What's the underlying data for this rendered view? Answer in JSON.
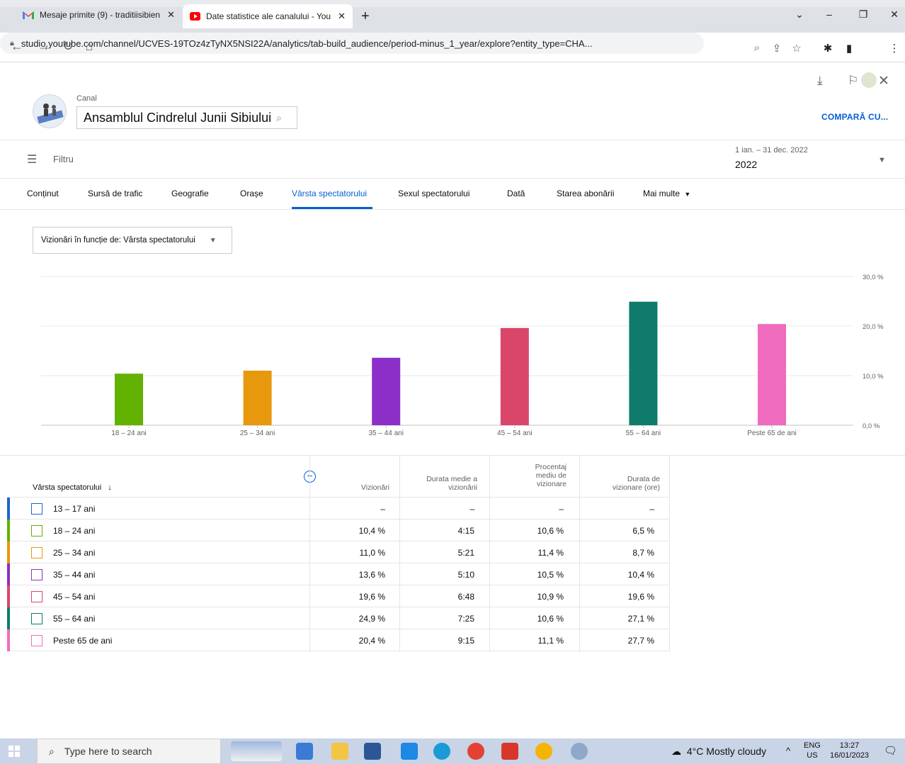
{
  "browser": {
    "tabs": [
      {
        "title": "Mesaje primite (9) - traditiisibien"
      },
      {
        "title": "Date statistice ale canalului - You"
      }
    ],
    "url": "studio.youtube.com/channel/UCVES-19TOz4zTyNX5NSI22A/analytics/tab-build_audience/period-minus_1_year/explore?entity_type=CHA..."
  },
  "header": {
    "canal_label": "Canal",
    "channel_name": "Ansamblul Cindrelul Junii Sibiului",
    "compare_label": "COMPARĂ CU..."
  },
  "filter": {
    "label": "Filtru",
    "date_range": "1 ian. – 31 dec. 2022",
    "date_value": "2022"
  },
  "report_tabs": [
    {
      "label": "Conținut"
    },
    {
      "label": "Sursă de trafic"
    },
    {
      "label": "Geografie"
    },
    {
      "label": "Orașe"
    },
    {
      "label": "Vârsta spectatorului",
      "active": true
    },
    {
      "label": "Sexul spectatorului"
    },
    {
      "label": "Dată"
    },
    {
      "label": "Starea abonării"
    },
    {
      "label": "Mai multe"
    }
  ],
  "metric_select": {
    "label": "Vizionări în funcție de: Vârsta spectatorului"
  },
  "chart_data": {
    "type": "bar",
    "title": "",
    "xlabel": "",
    "ylabel": "",
    "categories": [
      "18 – 24 ani",
      "25 – 34 ani",
      "35 – 44 ani",
      "45 – 54 ani",
      "55 – 64 ani",
      "Peste 65 de ani"
    ],
    "values": [
      10.4,
      11.0,
      13.6,
      19.6,
      24.9,
      20.4
    ],
    "colors": [
      "#63b100",
      "#e8980d",
      "#8c2fc9",
      "#d9466a",
      "#0f7b6c",
      "#ef6cbe"
    ],
    "ylim": [
      0,
      30
    ],
    "yticks": [
      "0,0 %",
      "10,0 %",
      "20,0 %",
      "30,0 %"
    ],
    "grid": true
  },
  "table": {
    "headers": {
      "dimension": "Vârsta spectatorului",
      "views": "Vizionări",
      "avg_duration": [
        "Durata medie a",
        "vizionării"
      ],
      "avg_percent": [
        "Procentaj",
        "mediu de",
        "vizionare"
      ],
      "watch_time": [
        "Durata de",
        "vizionare (ore)"
      ]
    },
    "rows": [
      {
        "label": "13 – 17 ani",
        "views": "–",
        "avg_duration": "–",
        "avg_percent": "–",
        "watch_time": "–",
        "color": "#1b66c9"
      },
      {
        "label": "18 – 24 ani",
        "views": "10,4 %",
        "avg_duration": "4:15",
        "avg_percent": "10,6 %",
        "watch_time": "6,5 %",
        "color": "#63b100"
      },
      {
        "label": "25 – 34 ani",
        "views": "11,0 %",
        "avg_duration": "5:21",
        "avg_percent": "11,4 %",
        "watch_time": "8,7 %",
        "color": "#e8980d"
      },
      {
        "label": "35 – 44 ani",
        "views": "13,6 %",
        "avg_duration": "5:10",
        "avg_percent": "10,5 %",
        "watch_time": "10,4 %",
        "color": "#8c2fc9"
      },
      {
        "label": "45 – 54 ani",
        "views": "19,6 %",
        "avg_duration": "6:48",
        "avg_percent": "10,9 %",
        "watch_time": "19,6 %",
        "color": "#d9466a"
      },
      {
        "label": "55 – 64 ani",
        "views": "24,9 %",
        "avg_duration": "7:25",
        "avg_percent": "10,6 %",
        "watch_time": "27,1 %",
        "color": "#0f7b6c"
      },
      {
        "label": "Peste 65 de ani",
        "views": "20,4 %",
        "avg_duration": "9:15",
        "avg_percent": "11,1 %",
        "watch_time": "27,7 %",
        "color": "#ef6cbe"
      }
    ]
  },
  "taskbar": {
    "search_placeholder": "Type here to search",
    "weather": "4°C  Mostly cloudy",
    "lang_top": "ENG",
    "lang_bottom": "US",
    "time": "13:27",
    "date": "16/01/2023"
  }
}
